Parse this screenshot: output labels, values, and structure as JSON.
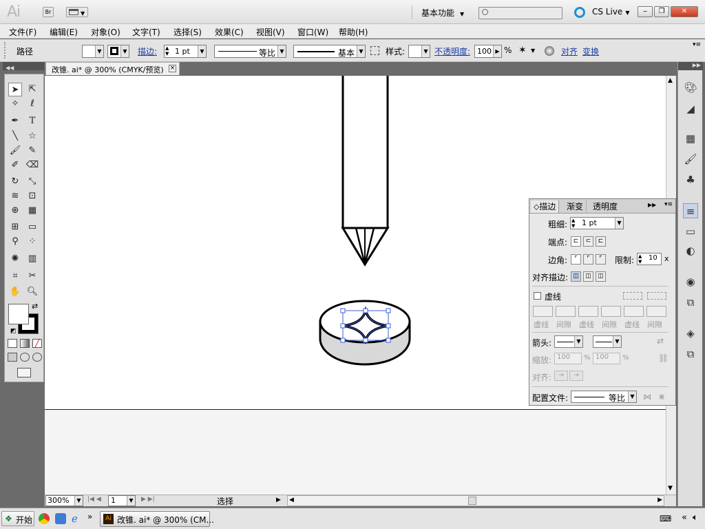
{
  "app": {
    "logo": "Ai",
    "bridge_label": "Br",
    "workspace": "基本功能",
    "cslive": "CS Live"
  },
  "menu": [
    "文件(F)",
    "编辑(E)",
    "对象(O)",
    "文字(T)",
    "选择(S)",
    "效果(C)",
    "视图(V)",
    "窗口(W)",
    "帮助(H)"
  ],
  "control": {
    "object_type": "路径",
    "stroke_label": "描边:",
    "stroke_weight": "1 pt",
    "profile": "等比",
    "brush": "基本",
    "style_label": "样式:",
    "opacity_label": "不透明度:",
    "opacity_value": "100",
    "opacity_unit": "%",
    "align_link": "对齐",
    "transform_link": "变换"
  },
  "document": {
    "tab_title": "改锥. ai* @ 300% (CMYK/预览)",
    "close": "×"
  },
  "stroke_panel": {
    "tabs": [
      "描边",
      "渐变",
      "透明度"
    ],
    "weight_label": "粗细:",
    "weight_value": "1 pt",
    "cap_label": "端点:",
    "corner_label": "边角:",
    "limit_label": "限制:",
    "limit_value": "10",
    "limit_unit": "x",
    "align_label": "对齐描边:",
    "dashed_label": "虚线",
    "dash_labels": [
      "虚线",
      "间隙",
      "虚线",
      "间隙",
      "虚线",
      "间隙"
    ],
    "arrow_label": "箭头:",
    "scale_label": "缩放:",
    "scale_a": "100",
    "scale_b": "100",
    "pct": "%",
    "align_arrow_label": "对齐:",
    "profile_label": "配置文件:",
    "profile_value": "等比"
  },
  "status": {
    "zoom": "300%",
    "page": "1",
    "tool": "选择"
  },
  "taskbar": {
    "start": "开始",
    "task": "改锥. ai* @ 300% (CM..."
  }
}
